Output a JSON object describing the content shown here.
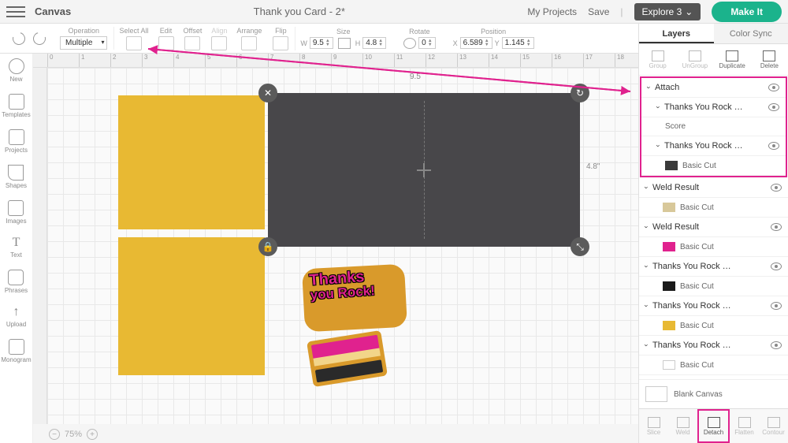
{
  "top": {
    "app_name": "Canvas",
    "doc_title": "Thank you Card - 2*",
    "my_projects": "My Projects",
    "save": "Save",
    "explore": "Explore 3",
    "make_it": "Make It"
  },
  "toolbar": {
    "operation_label": "Operation",
    "operation_value": "Multiple",
    "select_all": "Select All",
    "edit": "Edit",
    "offset": "Offset",
    "align": "Align",
    "arrange": "Arrange",
    "flip": "Flip",
    "size": "Size",
    "w": "W",
    "w_val": "9.5",
    "h": "H",
    "h_val": "4.8",
    "rotate": "Rotate",
    "rotate_val": "0",
    "position": "Position",
    "x": "X",
    "x_val": "6.589",
    "y": "Y",
    "y_val": "1.145"
  },
  "rail": {
    "new": "New",
    "templates": "Templates",
    "projects": "Projects",
    "shapes": "Shapes",
    "images": "Images",
    "text": "Text",
    "phrases": "Phrases",
    "upload": "Upload",
    "monogram": "Monogram"
  },
  "canvas": {
    "dim_w": "9.5",
    "dim_h": "4.8\"",
    "zoom": "75%",
    "thanks_line1": "Thanks",
    "thanks_line2": "you Rock!"
  },
  "panel": {
    "tab_layers": "Layers",
    "tab_color": "Color Sync",
    "tool_group": "Group",
    "tool_ungroup": "UnGroup",
    "tool_duplicate": "Duplicate",
    "tool_delete": "Delete",
    "attach": "Attach",
    "score": "Score",
    "basic_cut": "Basic Cut",
    "layer_thanks": "Thanks You Rock …",
    "layer_thanks_ca": "Thanks You Rock Ca…",
    "weld_result": "Weld Result",
    "blank_canvas": "Blank Canvas",
    "bt_slice": "Slice",
    "bt_weld": "Weld",
    "bt_detach": "Detach",
    "bt_flatten": "Flatten",
    "bt_contour": "Contour"
  },
  "ruler": [
    "0",
    "1",
    "2",
    "3",
    "4",
    "5",
    "6",
    "7",
    "8",
    "9",
    "10",
    "11",
    "12",
    "13",
    "14",
    "15",
    "16",
    "17",
    "18"
  ]
}
